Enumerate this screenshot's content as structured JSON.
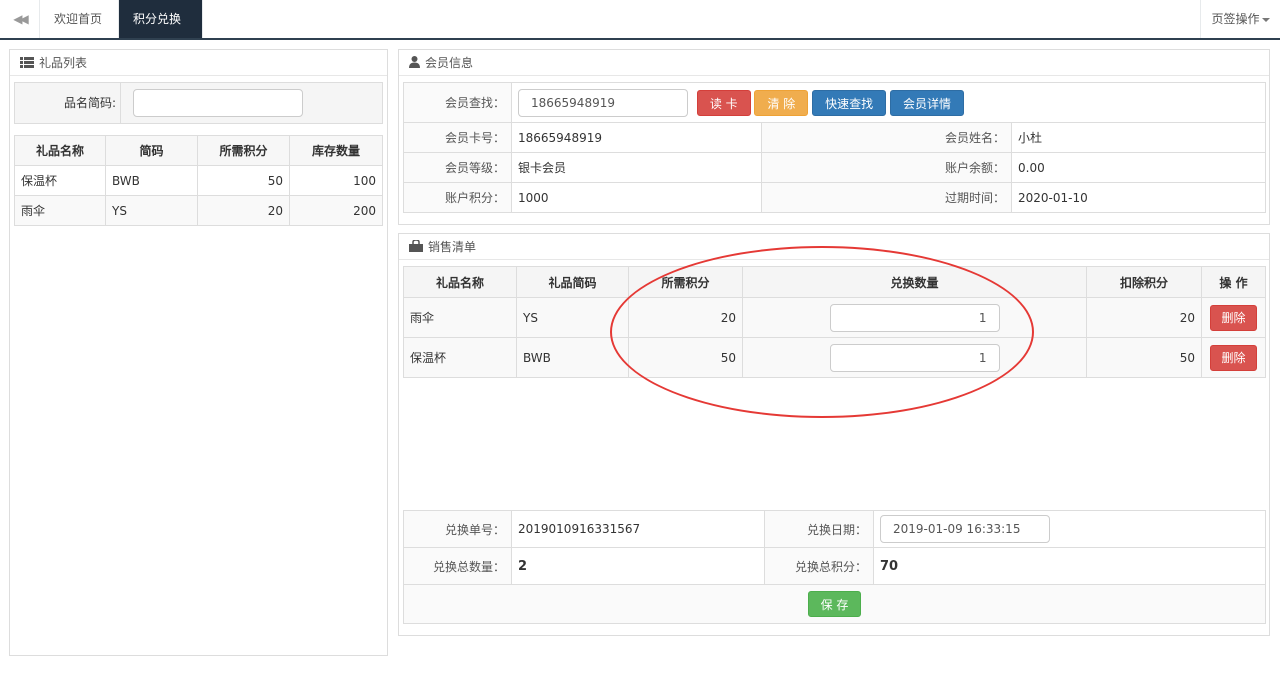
{
  "topbar": {
    "back_icon": "double-left-arrow-icon",
    "tab_home": "欢迎首页",
    "tab_active": "积分兑换",
    "tab_close": "✖",
    "ops_label": "页签操作"
  },
  "gift_panel": {
    "title": "礼品列表",
    "icon": "list-icon",
    "search_label": "品名简码:",
    "search_value": "",
    "headers": [
      "礼品名称",
      "简码",
      "所需积分",
      "库存数量"
    ],
    "rows": [
      {
        "name": "保温杯",
        "code": "BWB",
        "points": "50",
        "stock": "100"
      },
      {
        "name": "雨伞",
        "code": "YS",
        "points": "20",
        "stock": "200"
      }
    ]
  },
  "member_panel": {
    "title": "会员信息",
    "icon": "user-icon",
    "search_label": "会员查找：",
    "search_value": "18665948919",
    "buttons": {
      "read": "读 卡",
      "clear": "清 除",
      "quick": "快速查找",
      "detail": "会员详情"
    },
    "card_label": "会员卡号：",
    "card_value": "18665948919",
    "name_label": "会员姓名：",
    "name_value": "小杜",
    "level_label": "会员等级：",
    "level_value": "银卡会员",
    "balance_label": "账户余额：",
    "balance_value": "0.00",
    "points_label": "账户积分：",
    "points_value": "1000",
    "expire_label": "过期时间：",
    "expire_value": "2020-01-10"
  },
  "sales_panel": {
    "title": "销售清单",
    "icon": "shopping-bag-icon",
    "headers": [
      "礼品名称",
      "礼品简码",
      "所需积分",
      "兑换数量",
      "扣除积分",
      "操 作"
    ],
    "rows": [
      {
        "name": "雨伞",
        "code": "YS",
        "points": "20",
        "qty": "1",
        "deduct": "20",
        "action": "删除"
      },
      {
        "name": "保温杯",
        "code": "BWB",
        "points": "50",
        "qty": "1",
        "deduct": "50",
        "action": "删除"
      }
    ],
    "order_label": "兑换单号：",
    "order_value": "201901091633 1567",
    "date_label": "兑换日期：",
    "date_value": "2019-01-09 16:33:15",
    "total_qty_label": "兑换总数量：",
    "total_qty_value": "2",
    "total_points_label": "兑换总积分：",
    "total_points_value": "70",
    "save_label": "保 存"
  },
  "colors": {
    "nav_dark": "#1f2d3d",
    "danger": "#d9534f",
    "warning": "#f0ad4e",
    "primary": "#337ab7",
    "success": "#5cb85c",
    "annotation_circle": "#e53935"
  }
}
